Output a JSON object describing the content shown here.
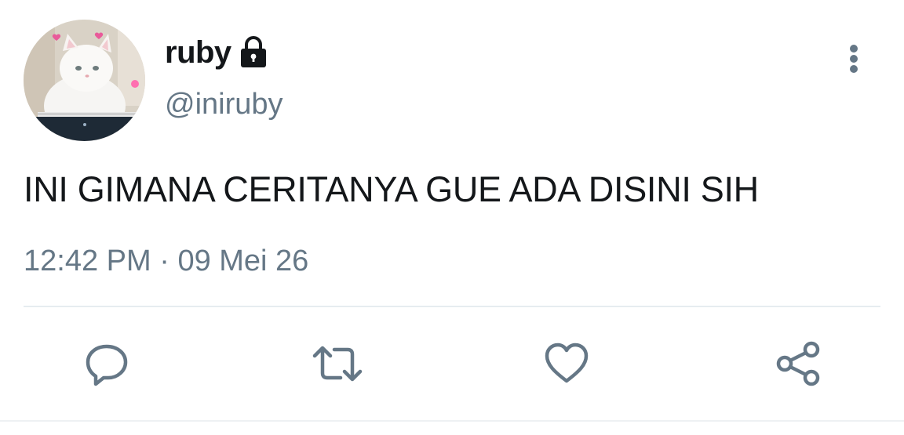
{
  "tweet": {
    "display_name": "ruby",
    "handle": "@iniruby",
    "text": "INI GIMANA CERITANYA GUE ADA DISINI SIH",
    "time": "12:42 PM",
    "separator": "·",
    "date": "09 Mei 26",
    "protected": true
  },
  "icons": {
    "lock": "lock-icon",
    "more": "vertical-dots-icon",
    "reply": "reply-bubble-icon",
    "retweet": "retweet-icon",
    "like": "heart-icon",
    "share": "share-icon"
  },
  "colors": {
    "text_primary": "#14171a",
    "text_secondary": "#657786",
    "divider": "#e6ecf0",
    "icon": "#657786"
  }
}
